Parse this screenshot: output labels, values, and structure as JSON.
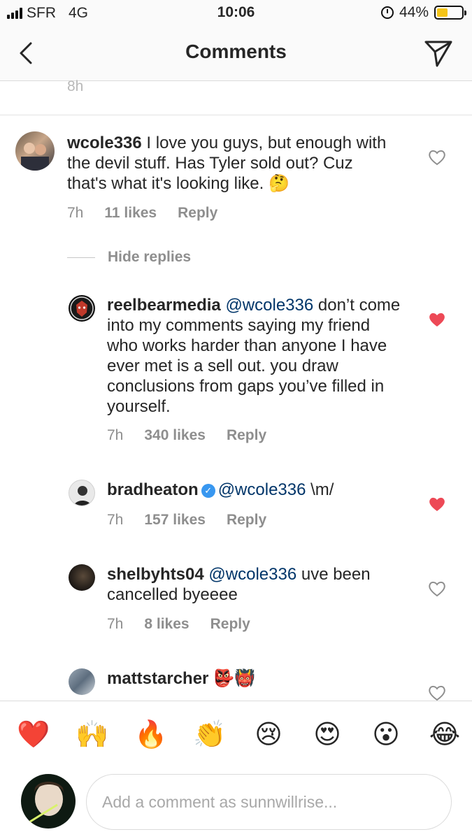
{
  "status_bar": {
    "carrier": "SFR",
    "network": "4G",
    "time": "10:06",
    "battery": "44%",
    "battery_level": 0.44
  },
  "header": {
    "title": "Comments",
    "back_icon": "chevron-left-icon",
    "send_icon": "paper-plane-icon"
  },
  "previous_comment_time": "8h",
  "comment": {
    "username": "wcole336",
    "text": " I love you guys,  but enough with the devil stuff.  Has Tyler sold out? Cuz that's what it's looking like. 🤔",
    "time": "7h",
    "likes": "11 likes",
    "reply": "Reply",
    "liked": false
  },
  "hide_replies": "Hide replies",
  "replies": [
    {
      "username": "reelbearmedia",
      "mention": "@wcole336",
      "text": " don’t come into my comments saying my friend who works harder than anyone I have ever met is a sell out. you draw conclusions from gaps you’ve filled in yourself.",
      "time": "7h",
      "likes": "340 likes",
      "reply": "Reply",
      "liked": true
    },
    {
      "username": "bradheaton",
      "verified": true,
      "mention": "@wcole336",
      "text": " \\m/",
      "time": "7h",
      "likes": "157 likes",
      "reply": "Reply",
      "liked": true
    },
    {
      "username": "shelbyhts04",
      "mention": "@wcole336",
      "text": " uve been cancelled byeeee",
      "time": "7h",
      "likes": "8 likes",
      "reply": "Reply",
      "liked": false
    },
    {
      "username": "mattstarcher",
      "mention": "",
      "text": " 👺👹",
      "liked": false
    }
  ],
  "emoji_bar": [
    "❤️",
    "🙌",
    "🔥",
    "👏",
    "😢",
    "😍",
    "😮",
    "😂"
  ],
  "input": {
    "placeholder": "Add a comment as sunnwillrise..."
  },
  "colors": {
    "liked_heart": "#ed4956",
    "mention": "#003569",
    "verified": "#3897f0"
  }
}
